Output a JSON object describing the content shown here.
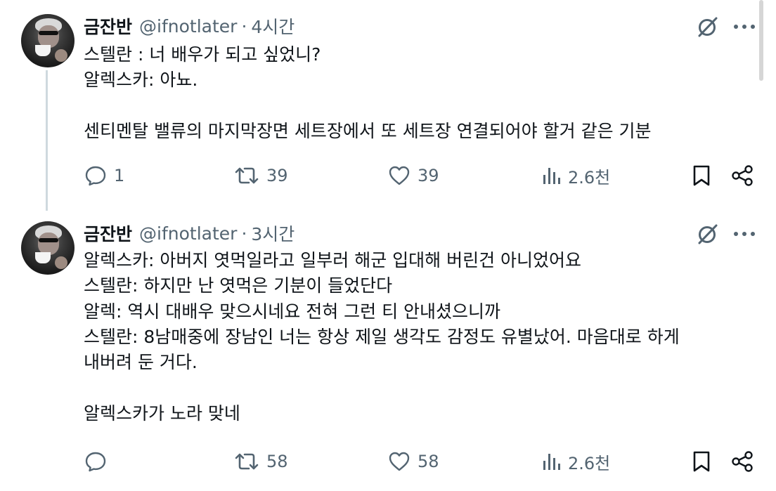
{
  "posts": [
    {
      "display_name": "금잔반",
      "handle": "@ifnotlater",
      "separator": "·",
      "time": "4시간",
      "body": "스텔란 : 너 배우가 되고 싶었니?\n알렉스카: 아뇨.\n\n센티멘탈 밸류의 마지막장면 세트장에서 또 세트장 연결되어야 할거 같은 기분",
      "replies": "1",
      "reposts": "39",
      "likes": "39",
      "views": "2.6천"
    },
    {
      "display_name": "금잔반",
      "handle": "@ifnotlater",
      "separator": "·",
      "time": "3시간",
      "body": "알렉스카: 아버지 엿먹일라고 일부러 해군 입대해 버린건 아니었어요\n스텔란: 하지만 난 엿먹은 기분이 들었단다\n알렉: 역시 대배우 맞으시네요 전혀 그런 티 안내셨으니까\n스텔란: 8남매중에 장남인 너는 항상 제일 생각도 감정도 유별났어. 마음대로 하게\n내버려 둔 거다.\n\n알렉스카가 노라 맞네",
      "replies": "",
      "reposts": "58",
      "likes": "58",
      "views": "2.6천"
    }
  ],
  "icons": [
    "grok-icon",
    "more-icon",
    "reply-icon",
    "repost-icon",
    "like-icon",
    "views-icon",
    "bookmark-icon",
    "share-icon"
  ],
  "colors": {
    "text": "#0f1419",
    "secondary": "#536471",
    "thread_line": "#cfd9de"
  }
}
